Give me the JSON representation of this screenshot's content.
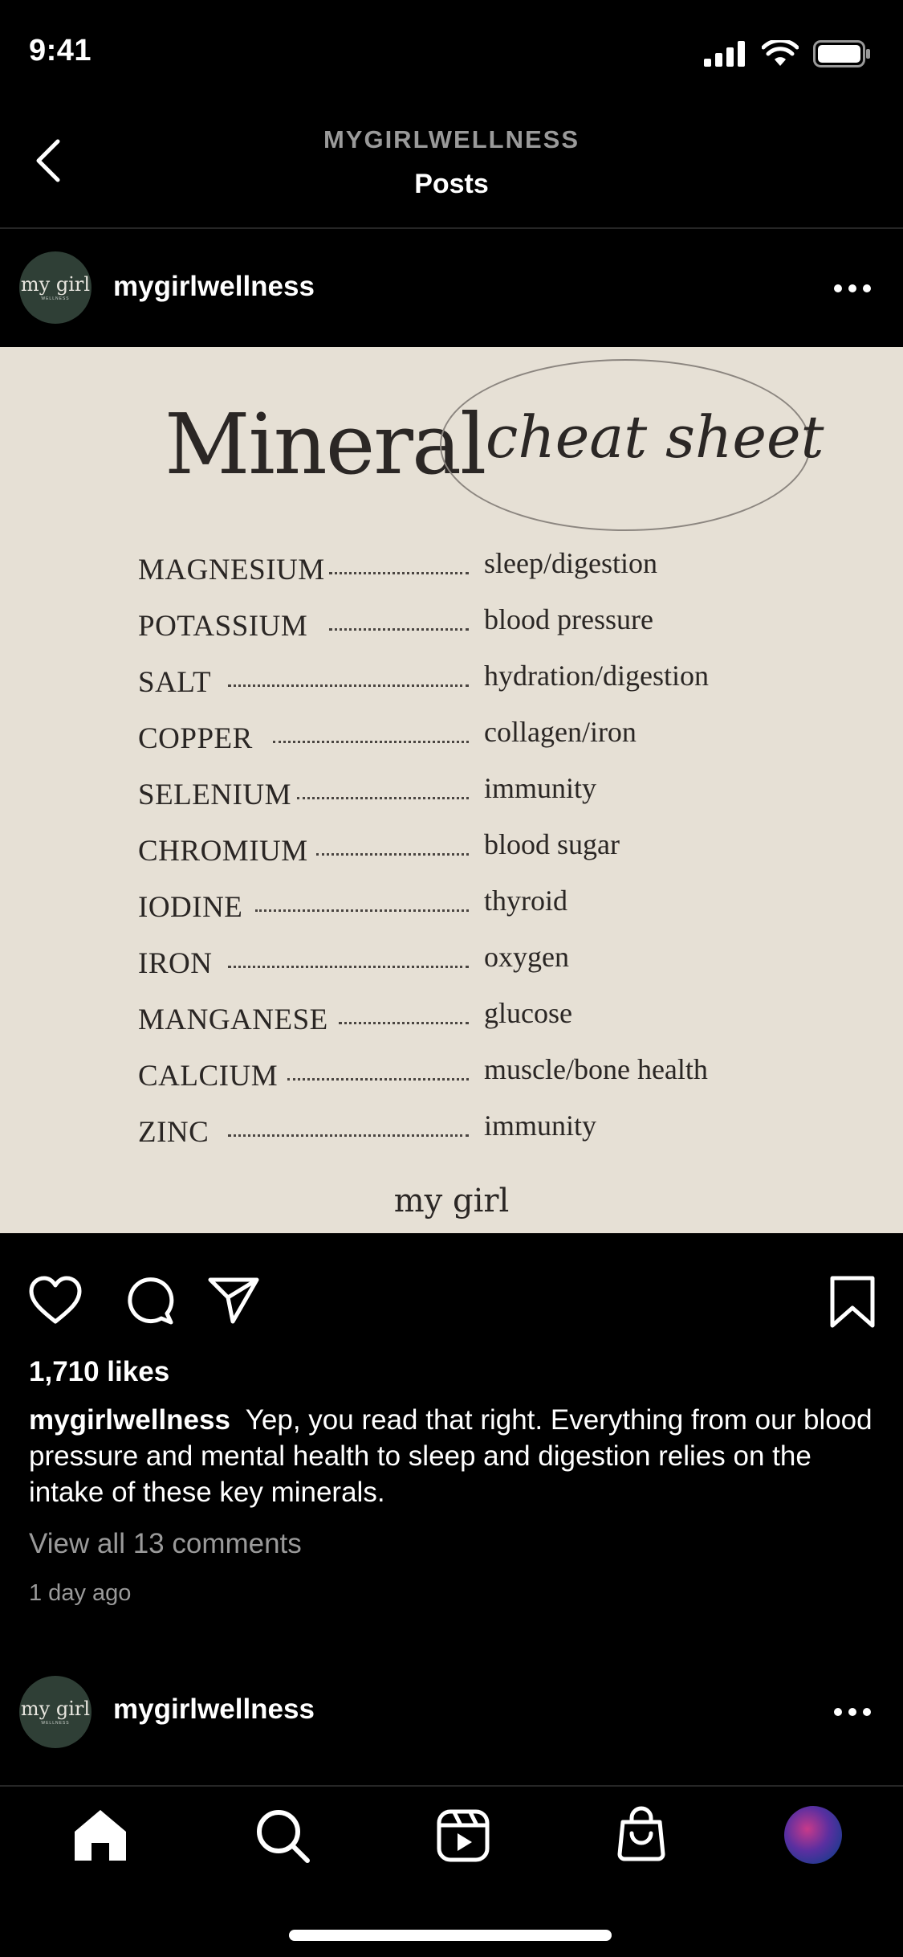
{
  "status_bar": {
    "time": "9:41"
  },
  "header": {
    "account": "MYGIRLWELLNESS",
    "title": "Posts"
  },
  "post": {
    "username": "mygirlwellness",
    "avatar_text": "my girl",
    "avatar_subtext": "WELLNESS",
    "image": {
      "title_main": "Mineral",
      "title_script": "cheat sheet",
      "minerals": [
        {
          "name": "MAGNESIUM",
          "use": "sleep/digestion"
        },
        {
          "name": "POTASSIUM",
          "use": "blood pressure"
        },
        {
          "name": "SALT",
          "use": "hydration/digestion"
        },
        {
          "name": "COPPER",
          "use": "collagen/iron"
        },
        {
          "name": "SELENIUM",
          "use": "immunity"
        },
        {
          "name": "CHROMIUM",
          "use": "blood sugar"
        },
        {
          "name": "IODINE",
          "use": "thyroid"
        },
        {
          "name": "IRON",
          "use": "oxygen"
        },
        {
          "name": "MANGANESE",
          "use": "glucose"
        },
        {
          "name": "CALCIUM",
          "use": "muscle/bone health"
        },
        {
          "name": "ZINC",
          "use": "immunity"
        }
      ],
      "brand": "my girl"
    },
    "likes": "1,710 likes",
    "caption_user": "mygirlwellness",
    "caption_text": "Yep, you read that right. Everything from our blood pressure and mental health to sleep and digestion relies on the intake of these key minerals.",
    "view_comments": "View all 13 comments",
    "time_ago": "1 day ago"
  },
  "next_post": {
    "username": "mygirlwellness"
  },
  "icons": {
    "back": "chevron-left-icon",
    "more": "more-horizontal-icon",
    "like": "heart-icon",
    "comment": "comment-icon",
    "share": "send-icon",
    "save": "bookmark-icon",
    "nav": [
      "home-icon",
      "search-icon",
      "reels-icon",
      "shop-icon",
      "profile-avatar"
    ]
  },
  "colors": {
    "background": "#000000",
    "post_bg": "#e6e0d5",
    "secondary_text": "#9a9a9a",
    "avatar_bg": "#2f3f36"
  }
}
